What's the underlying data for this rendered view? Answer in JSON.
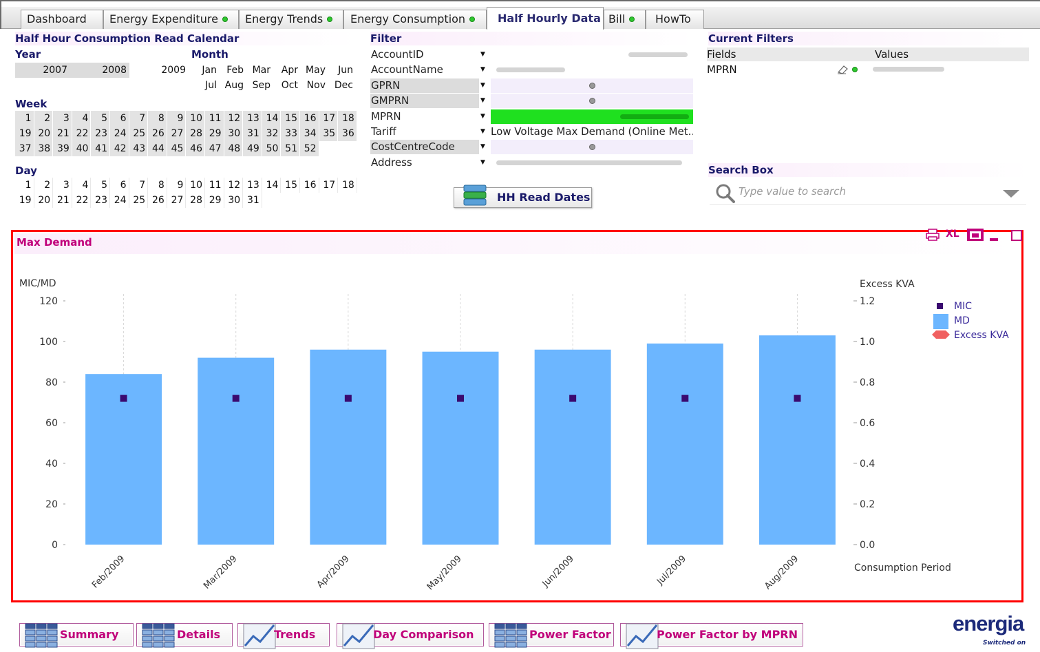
{
  "tabs": [
    {
      "label": "Dashboard",
      "dot": false
    },
    {
      "label": "Energy Expenditure",
      "dot": true
    },
    {
      "label": "Energy Trends",
      "dot": true
    },
    {
      "label": "Energy Consumption",
      "dot": true
    },
    {
      "label": "Half Hourly Data",
      "dot": false,
      "active": true
    },
    {
      "label": "Bill",
      "dot": true
    },
    {
      "label": "HowTo",
      "dot": false
    }
  ],
  "calendar": {
    "title": "Half Hour Consumption Read Calendar",
    "year_label": "Year",
    "years": [
      "2007",
      "2008",
      "2009"
    ],
    "month_label": "Month",
    "months": [
      "Jan",
      "Feb",
      "Mar",
      "Apr",
      "May",
      "Jun",
      "Jul",
      "Aug",
      "Sep",
      "Oct",
      "Nov",
      "Dec"
    ],
    "week_label": "Week",
    "weeks": [
      "1",
      "2",
      "3",
      "4",
      "5",
      "6",
      "7",
      "8",
      "9",
      "10",
      "11",
      "12",
      "13",
      "14",
      "15",
      "16",
      "17",
      "18",
      "19",
      "20",
      "21",
      "22",
      "23",
      "24",
      "25",
      "26",
      "27",
      "28",
      "29",
      "30",
      "31",
      "32",
      "33",
      "34",
      "35",
      "36",
      "37",
      "38",
      "39",
      "40",
      "41",
      "42",
      "43",
      "44",
      "45",
      "46",
      "47",
      "48",
      "49",
      "50",
      "51",
      "52"
    ],
    "day_label": "Day",
    "days": [
      "1",
      "2",
      "3",
      "4",
      "5",
      "6",
      "7",
      "8",
      "9",
      "10",
      "11",
      "12",
      "13",
      "14",
      "15",
      "16",
      "17",
      "18",
      "19",
      "20",
      "21",
      "22",
      "23",
      "24",
      "25",
      "26",
      "27",
      "28",
      "29",
      "30",
      "31"
    ]
  },
  "filter": {
    "title": "Filter",
    "rows": [
      {
        "label": "AccountID",
        "value": "",
        "style": "plain"
      },
      {
        "label": "AccountName",
        "value": "",
        "style": "plain"
      },
      {
        "label": "GPRN",
        "value": "",
        "style": "empty"
      },
      {
        "label": "GMPRN",
        "value": "",
        "style": "empty"
      },
      {
        "label": "MPRN",
        "value": "",
        "style": "selected"
      },
      {
        "label": "Tariff",
        "value": "Low Voltage Max Demand (Online Met…",
        "style": "plain"
      },
      {
        "label": "CostCentreCode",
        "value": "",
        "style": "empty"
      },
      {
        "label": "Address",
        "value": "",
        "style": "plain"
      }
    ],
    "button_label": "HH Read Dates"
  },
  "current_filters": {
    "title": "Current Filters",
    "col_fields": "Fields",
    "col_values": "Values",
    "field": "MPRN"
  },
  "search": {
    "title": "Search Box",
    "placeholder": "Type value to search"
  },
  "chart_panel": {
    "title": "Max Demand",
    "toolbar": [
      "print-icon",
      "excel-icon",
      "restore-icon",
      "minimize-icon",
      "maximize-icon"
    ],
    "excel_label": "XL"
  },
  "chart_data": {
    "type": "bar",
    "categories": [
      "Feb/2009",
      "Mar/2009",
      "Apr/2009",
      "May/2009",
      "Jun/2009",
      "Jul/2009",
      "Aug/2009"
    ],
    "series": [
      {
        "name": "MIC",
        "kind": "marker",
        "axis": "left",
        "color": "#3a0a70",
        "values": [
          72,
          72,
          72,
          72,
          72,
          72,
          72
        ]
      },
      {
        "name": "MD",
        "kind": "bar",
        "axis": "left",
        "color": "#6cb6ff",
        "values": [
          84,
          92,
          96,
          95,
          96,
          99,
          103
        ]
      },
      {
        "name": "Excess KVA",
        "kind": "line",
        "axis": "right",
        "color": "#f06060",
        "values": [
          0,
          0,
          0,
          0,
          0,
          0,
          0
        ]
      }
    ],
    "ylabel": "MIC/MD",
    "y2label": "Excess KVA",
    "xlabel": "Consumption Period",
    "ylim": [
      0,
      120
    ],
    "y2lim": [
      0,
      1.2
    ],
    "yticks": [
      "0",
      "20",
      "40",
      "60",
      "80",
      "100",
      "120"
    ],
    "y2ticks": [
      "0.0",
      "0.2",
      "0.4",
      "0.6",
      "0.8",
      "1.0",
      "1.2"
    ],
    "grid": true,
    "legend": "top-right"
  },
  "bottom_buttons": [
    {
      "label": "Summary",
      "icon": "table-icon"
    },
    {
      "label": "Details",
      "icon": "table-icon"
    },
    {
      "label": "Trends",
      "icon": "line-chart-icon"
    },
    {
      "label": "Day Comparison",
      "icon": "line-chart-icon"
    },
    {
      "label": "Power Factor",
      "icon": "table-icon"
    },
    {
      "label": "Power Factor by MPRN",
      "icon": "line-chart-icon"
    }
  ],
  "logo": {
    "name": "energia",
    "tagline": "Switched on"
  },
  "colors": {
    "accent": "#c0007a",
    "title": "#1a1a6a",
    "bar": "#6cb6ff",
    "selected": "#1fe01f",
    "highlight": "#ff0000"
  }
}
